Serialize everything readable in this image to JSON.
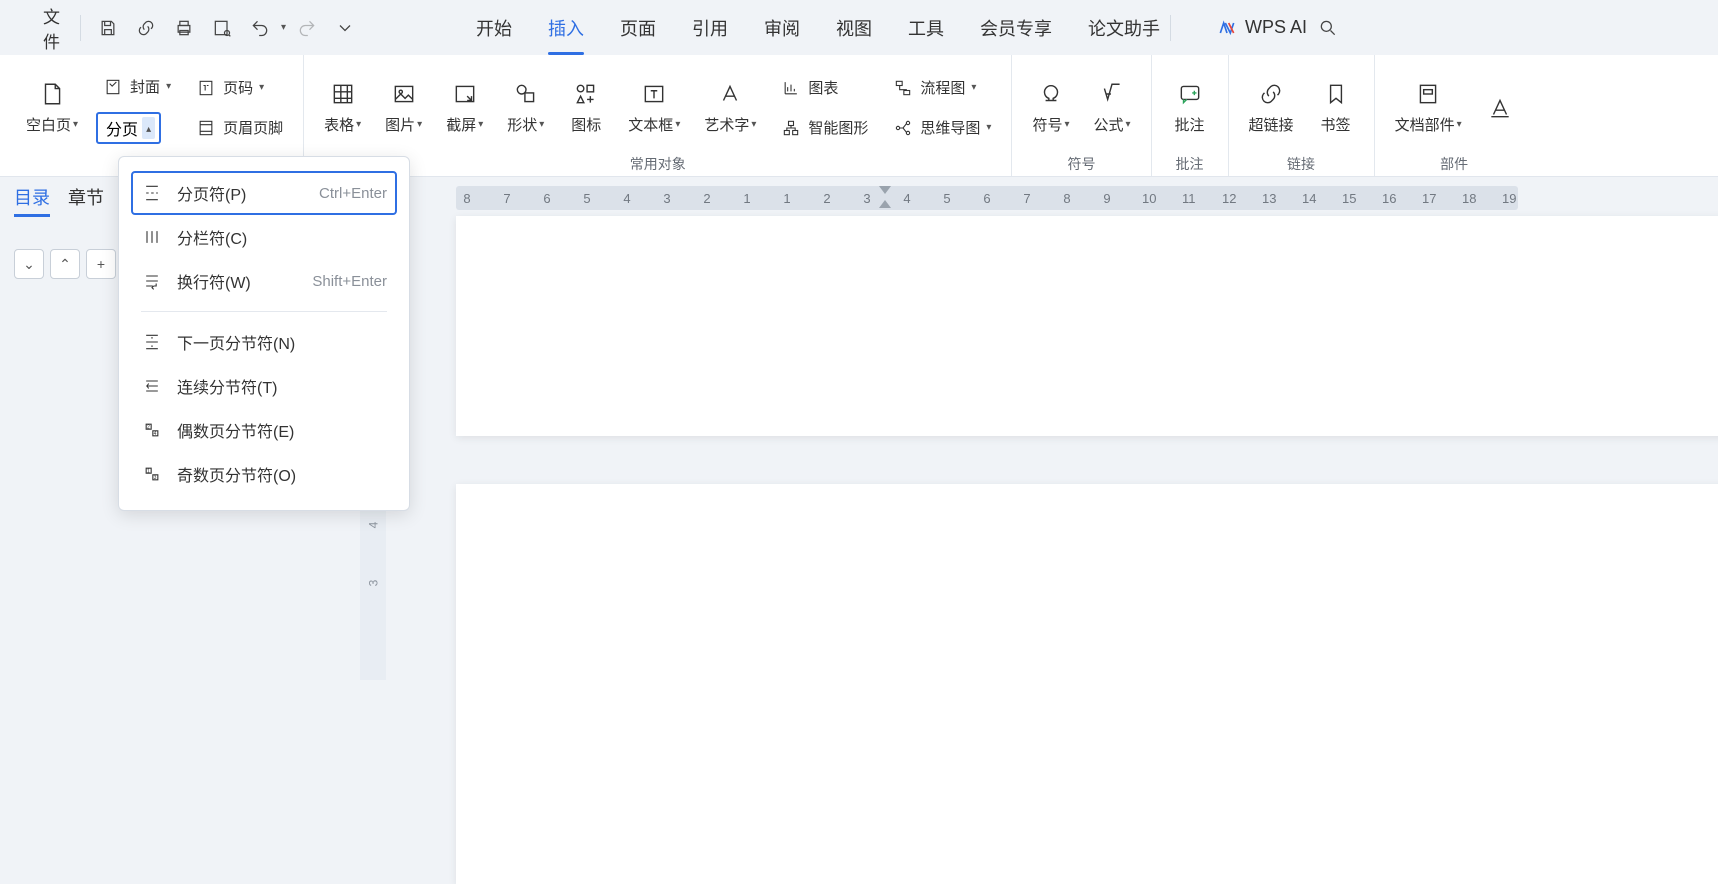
{
  "topbar": {
    "file_label": "文件"
  },
  "menu": {
    "tabs": [
      "开始",
      "插入",
      "页面",
      "引用",
      "审阅",
      "视图",
      "工具",
      "会员专享",
      "论文助手"
    ],
    "active_index": 1
  },
  "ai": {
    "label": "WPS AI"
  },
  "ribbon": {
    "blank_page": "空白页",
    "cover": "封面",
    "page_number": "页码",
    "split_page": "分页",
    "header_footer": "页眉页脚",
    "table": "表格",
    "picture": "图片",
    "screenshot": "截屏",
    "shape": "形状",
    "icon": "图标",
    "textbox": "文本框",
    "wordart": "艺术字",
    "chart": "图表",
    "smartart": "智能图形",
    "flowchart": "流程图",
    "mindmap": "思维导图",
    "symbol": "符号",
    "equation": "公式",
    "comment": "批注",
    "hyperlink": "超链接",
    "bookmark": "书签",
    "docparts": "文档部件",
    "group_common": "常用对象",
    "group_symbol": "符号",
    "group_comment": "批注",
    "group_link": "链接",
    "group_parts": "部件"
  },
  "side": {
    "tabs": [
      "目录",
      "章节"
    ],
    "active_index": 0
  },
  "dropdown": {
    "items": [
      {
        "label": "分页符(P)",
        "shortcut": "Ctrl+Enter"
      },
      {
        "label": "分栏符(C)",
        "shortcut": ""
      },
      {
        "label": "换行符(W)",
        "shortcut": "Shift+Enter"
      },
      {
        "label": "下一页分节符(N)",
        "shortcut": ""
      },
      {
        "label": "连续分节符(T)",
        "shortcut": ""
      },
      {
        "label": "偶数页分节符(E)",
        "shortcut": ""
      },
      {
        "label": "奇数页分节符(O)",
        "shortcut": ""
      }
    ],
    "selected_index": 0
  },
  "ruler": {
    "left_numbers": [
      "8",
      "7",
      "6",
      "5",
      "4",
      "3",
      "2",
      "1"
    ],
    "right_numbers": [
      "1",
      "2",
      "3",
      "4",
      "5",
      "6",
      "7",
      "8",
      "9",
      "10",
      "11",
      "12",
      "13",
      "14",
      "15",
      "16",
      "17",
      "18",
      "19"
    ]
  },
  "vruler": {
    "marks": [
      "4",
      "3"
    ]
  }
}
